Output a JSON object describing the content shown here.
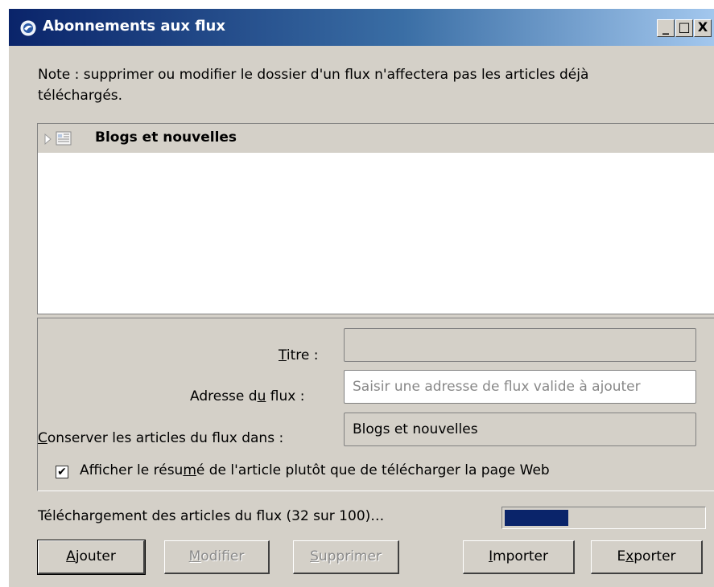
{
  "window": {
    "title": "Abonnements aux flux",
    "controls": {
      "minimize": "_",
      "maximize": "□",
      "close": "X"
    }
  },
  "note": "Note : supprimer ou modifier le dossier d'un flux n'affectera pas les articles déjà téléchargés.",
  "tree": {
    "items": [
      {
        "label": "Blogs et nouvelles",
        "icon": "folder-icon",
        "expanded": false
      }
    ]
  },
  "form": {
    "titre": {
      "label_pre": "",
      "label_ul": "T",
      "label_post": "itre :",
      "value": ""
    },
    "adresse": {
      "label_pre": "Adresse d",
      "label_ul": "u",
      "label_post": " flux :",
      "placeholder": "Saisir une adresse de flux valide à ajouter"
    },
    "conserver": {
      "label_pre": "",
      "label_ul": "C",
      "label_post": "onserver les articles du flux dans :",
      "value": "Blogs et nouvelles"
    },
    "resume": {
      "checked": true,
      "label_pre": "Afficher le résu",
      "label_ul": "m",
      "label_post": "é de l'article plutôt que de télécharger la page Web"
    }
  },
  "progress": {
    "text": "Téléchargement des articles du flux (32 sur 100)…",
    "fraction": 0.32,
    "color": "#0a246a"
  },
  "buttons": {
    "ajouter": {
      "ul": "A",
      "rest": "jouter"
    },
    "modifier": {
      "ul": "M",
      "rest": "odifier"
    },
    "supprimer": {
      "ul": "S",
      "rest": "upprimer"
    },
    "importer": {
      "ul": "I",
      "rest": "mporter"
    },
    "exporter": {
      "pre": "E",
      "ul": "x",
      "rest": "porter"
    }
  }
}
